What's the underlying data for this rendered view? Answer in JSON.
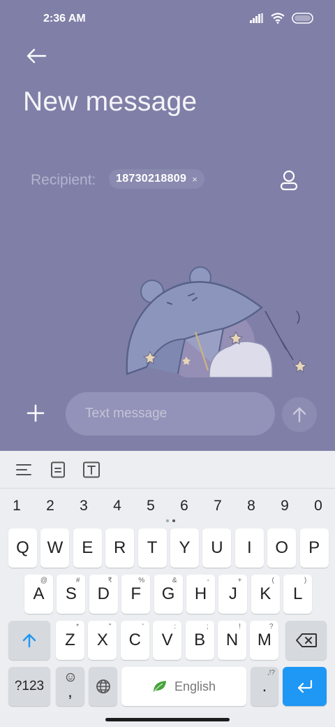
{
  "status_bar": {
    "time": "2:36 AM"
  },
  "header": {
    "title": "New message"
  },
  "recipient": {
    "label": "Recipient:",
    "chip_number": "18730218809",
    "chip_remove": "×"
  },
  "compose": {
    "placeholder": "Text message"
  },
  "keyboard": {
    "numbers": [
      "1",
      "2",
      "3",
      "4",
      "5",
      "6",
      "7",
      "8",
      "9",
      "0"
    ],
    "row1": [
      {
        "k": "Q"
      },
      {
        "k": "W"
      },
      {
        "k": "E"
      },
      {
        "k": "R"
      },
      {
        "k": "T"
      },
      {
        "k": "Y"
      },
      {
        "k": "U"
      },
      {
        "k": "I"
      },
      {
        "k": "O"
      },
      {
        "k": "P"
      }
    ],
    "row2": [
      {
        "k": "A",
        "h": "@"
      },
      {
        "k": "S",
        "h": "#"
      },
      {
        "k": "D",
        "h": "₹"
      },
      {
        "k": "F",
        "h": "%"
      },
      {
        "k": "G",
        "h": "&"
      },
      {
        "k": "H",
        "h": "-"
      },
      {
        "k": "J",
        "h": "+"
      },
      {
        "k": "K",
        "h": "("
      },
      {
        "k": "L",
        "h": ")"
      }
    ],
    "row3": [
      {
        "k": "Z",
        "h": "*"
      },
      {
        "k": "X",
        "h": "\""
      },
      {
        "k": "C",
        "h": "'"
      },
      {
        "k": "V",
        "h": ":"
      },
      {
        "k": "B",
        "h": ";"
      },
      {
        "k": "N",
        "h": "!"
      },
      {
        "k": "M",
        "h": "?"
      }
    ],
    "symbols_label": "?123",
    "comma_label": ",",
    "space_label": "English",
    "period_label": ".",
    "period_hint": ",!?"
  },
  "colors": {
    "app_background": "#7f7fa8",
    "accent_enter": "#1f97f4",
    "keyboard_background": "#eceef1"
  },
  "icons": [
    "back-arrow-icon",
    "contact-icon",
    "plus-icon",
    "send-arrow-icon",
    "signal-icon",
    "wifi-icon",
    "battery-icon",
    "menu-lines-icon",
    "clipboard-icon",
    "text-box-icon",
    "shift-icon",
    "backspace-icon",
    "emoji-icon",
    "globe-icon",
    "leaf-icon",
    "enter-icon"
  ]
}
